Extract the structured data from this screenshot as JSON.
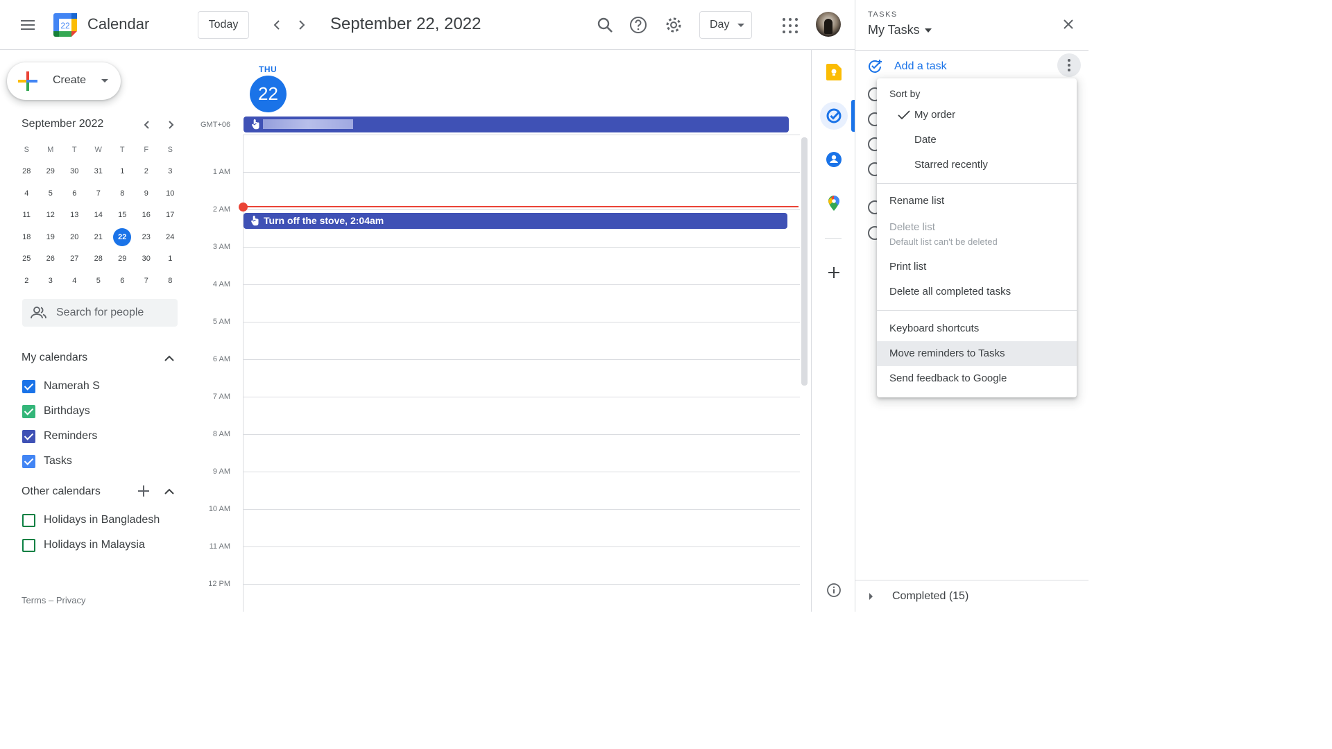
{
  "header": {
    "app_name": "Calendar",
    "logo_day": "22",
    "today_label": "Today",
    "date_title": "September 22, 2022",
    "view_label": "Day"
  },
  "sidebar": {
    "create_label": "Create",
    "mini_cal": {
      "title": "September 2022",
      "weekdays": [
        "S",
        "M",
        "T",
        "W",
        "T",
        "F",
        "S"
      ],
      "weeks": [
        [
          "28",
          "29",
          "30",
          "31",
          "1",
          "2",
          "3"
        ],
        [
          "4",
          "5",
          "6",
          "7",
          "8",
          "9",
          "10"
        ],
        [
          "11",
          "12",
          "13",
          "14",
          "15",
          "16",
          "17"
        ],
        [
          "18",
          "19",
          "20",
          "21",
          "22",
          "23",
          "24"
        ],
        [
          "25",
          "26",
          "27",
          "28",
          "29",
          "30",
          "1"
        ],
        [
          "2",
          "3",
          "4",
          "5",
          "6",
          "7",
          "8"
        ]
      ],
      "today": "22"
    },
    "search_placeholder": "Search for people",
    "my_calendars_title": "My calendars",
    "my_calendars": [
      {
        "label": "Namerah S",
        "color": "#1a73e8",
        "checked": true
      },
      {
        "label": "Birthdays",
        "color": "#33b679",
        "checked": true
      },
      {
        "label": "Reminders",
        "color": "#3f51b5",
        "checked": true
      },
      {
        "label": "Tasks",
        "color": "#4285f4",
        "checked": true
      }
    ],
    "other_calendars_title": "Other calendars",
    "other_calendars": [
      {
        "label": "Holidays in Bangladesh",
        "color": "#0b8043",
        "checked": false
      },
      {
        "label": "Holidays in Malaysia",
        "color": "#0b8043",
        "checked": false
      }
    ],
    "footer": "Terms – Privacy"
  },
  "day_view": {
    "weekday": "THU",
    "day_number": "22",
    "timezone": "GMT+06",
    "hours": [
      "1 AM",
      "2 AM",
      "3 AM",
      "4 AM",
      "5 AM",
      "6 AM",
      "7 AM",
      "8 AM",
      "9 AM",
      "10 AM",
      "11 AM",
      "12 PM"
    ],
    "event_title": "Turn off the stove, 2:04am",
    "event_color": "#3f51b5",
    "now_color": "#ea4335"
  },
  "side_icons": [
    "keep-icon",
    "tasks-icon",
    "contacts-icon",
    "maps-icon",
    "add-icon",
    "info-icon"
  ],
  "tasks_panel": {
    "label": "TASKS",
    "list_name": "My Tasks",
    "add_task_label": "Add a task",
    "completed_label": "Completed (15)"
  },
  "menu": {
    "sort_by": "Sort by",
    "sort_options": [
      "My order",
      "Date",
      "Starred recently"
    ],
    "selected_sort": "My order",
    "rename_list": "Rename list",
    "delete_list": "Delete list",
    "delete_list_note": "Default list can't be deleted",
    "print_list": "Print list",
    "delete_completed": "Delete all completed tasks",
    "keyboard_shortcuts": "Keyboard shortcuts",
    "move_reminders": "Move reminders to Tasks",
    "send_feedback": "Send feedback to Google"
  }
}
